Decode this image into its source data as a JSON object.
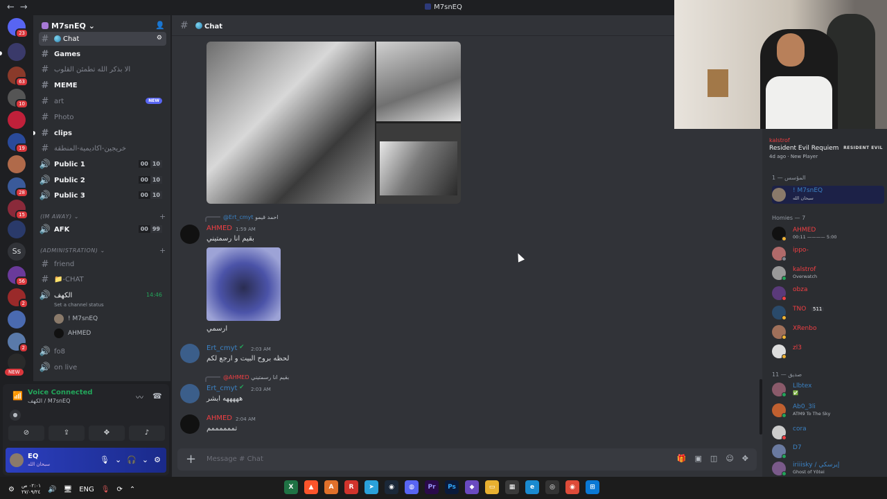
{
  "titlebar": {
    "back": "←",
    "forward": "→",
    "title": "M7snEQ"
  },
  "servers": {
    "badges": [
      "23",
      "63",
      "10",
      "19",
      "28",
      "15",
      "56",
      "2",
      "2"
    ],
    "text_server": "Ss",
    "new_label": "NEW"
  },
  "guild": {
    "name": "M7snEQ"
  },
  "channels": [
    {
      "name": "Chat"
    },
    {
      "name": "Games"
    },
    {
      "name": "ألا بذكر الله تطمئن القلوب"
    },
    {
      "name": "MEME"
    },
    {
      "name": "art",
      "tag": "NEW"
    },
    {
      "name": "Photo"
    },
    {
      "name": "clips"
    },
    {
      "name": "خريجين-اكاديمية-المنطقة"
    },
    {
      "name": "Public 1",
      "count": [
        "00",
        "10"
      ]
    },
    {
      "name": "Public 2",
      "count": [
        "00",
        "10"
      ]
    },
    {
      "name": "Public 3",
      "count": [
        "00",
        "10"
      ]
    }
  ],
  "category_away": "(IM AWAY)",
  "afk": {
    "name": "AFK",
    "count": [
      "00",
      "99"
    ]
  },
  "category_admin": "(ADMINISTRATION)",
  "admin_channels": [
    "friend",
    "-CHAT"
  ],
  "voice_channel": {
    "name": "الكهف",
    "time": "14:46",
    "status": "Set a channel status",
    "users": [
      "! M7snEQ",
      "AHMED"
    ]
  },
  "more_channels": [
    "fo8",
    "on live"
  ],
  "voice_panel": {
    "title": "Voice Connected",
    "sub": "الكهف / M7snEQ"
  },
  "user": {
    "name": "EQ",
    "status": "سبحان الله"
  },
  "chat": {
    "channel": "Chat",
    "placeholder": "Message # Chat",
    "messages": [
      {
        "reply_name": "@Ert_cmyt",
        "reply_text": "احمد قيمو",
        "author": "AHMED",
        "time": "1:59 AM",
        "text": "بقيم انا رسمتيني"
      },
      {
        "text": "ارسمي"
      },
      {
        "author": "Ert_cmyt",
        "time": "2:03 AM",
        "text": "لحظه بروح البيت و ارجع لكم"
      },
      {
        "reply_name": "@AHMED",
        "reply_text": "بقيم انا رسمتيني",
        "author": "Ert_cmyt",
        "time": "2:03 AM",
        "text": "هههههه ابشر"
      },
      {
        "author": "AHMED",
        "time": "2:04 AM",
        "text": "تممممممم"
      }
    ]
  },
  "activity": {
    "user": "kalstrof",
    "game": "Resident Evil Requiem",
    "ago": "4d ago",
    "detail": "New Player",
    "logo": "RESIDENT EVIL"
  },
  "members": {
    "owner_group": "المؤسس — 1",
    "owner": {
      "name": "! M7snEQ",
      "status": "سبحان الله"
    },
    "homies_group": "Homies — 7",
    "homies": [
      {
        "name": "AHMED",
        "status": "00:11 ———— 5:00",
        "color": "#f23f43"
      },
      {
        "name": "ippo-",
        "status": "",
        "color": "#f23f43"
      },
      {
        "name": "kalstrof",
        "status": "Overwatch",
        "color": "#f23f43"
      },
      {
        "name": "obza",
        "status": "",
        "color": "#f23f43"
      },
      {
        "name": "TNO",
        "status": "",
        "tag": "511",
        "color": "#f23f43"
      },
      {
        "name": "XRenbo",
        "status": "",
        "color": "#f23f43"
      },
      {
        "name": "zl3",
        "status": "",
        "color": "#f23f43"
      }
    ],
    "friends_group": "صديق — 11",
    "friends": [
      {
        "name": "Llbtex",
        "status": "✅",
        "color": "#3b82c4"
      },
      {
        "name": "Ab0_3li",
        "status": "ATM9 To The Sky",
        "color": "#3b82c4"
      },
      {
        "name": "cora",
        "status": "",
        "color": "#3b82c4"
      },
      {
        "name": "D7",
        "status": "",
        "color": "#3b82c4"
      },
      {
        "name": "iriiisky / إيرسكي",
        "status": "Ghost of Yōtei",
        "color": "#3b82c4"
      }
    ]
  },
  "taskbar": {
    "time": "٠٢:٠١ ص",
    "date": "٢٧/٠٩/٢٤",
    "lang": "ENG"
  },
  "colors": {
    "accent": "#5865f2",
    "red": "#f23f43",
    "green": "#23a55a"
  }
}
